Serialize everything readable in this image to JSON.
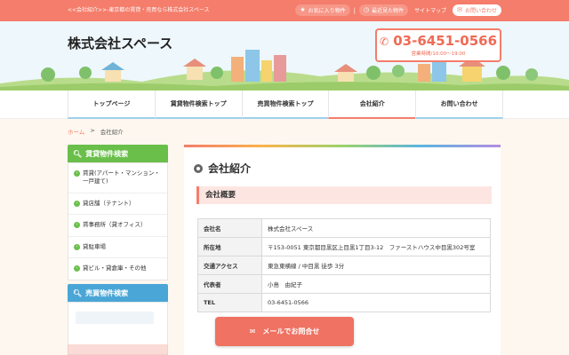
{
  "topbar": {
    "tagline": "<<会社紹介>>-東京都の賃貸・売買なら株式会社スペース",
    "favorites": "お気に入り物件",
    "recent": "最近見た物件",
    "sitemap": "サイトマップ",
    "contact": "お問い合わせ"
  },
  "header": {
    "company": "株式会社スペース",
    "phone": "03-6451-0566",
    "hours": "営業時間/10:00〜19:00"
  },
  "nav": [
    {
      "label": "トップページ"
    },
    {
      "label": "賃貸物件検索トップ"
    },
    {
      "label": "売買物件検索トップ"
    },
    {
      "label": "会社紹介"
    },
    {
      "label": "お問い合わせ"
    }
  ],
  "breadcrumb": {
    "home": "ホーム",
    "sep": ">",
    "current": "会社紹介"
  },
  "sidebar": {
    "rental_title": "賃貸物件検索",
    "rental_items": [
      {
        "label": "賃貸(アパート・マンション・一戸建て)"
      },
      {
        "label": "貸店舗（テナント）"
      },
      {
        "label": "賃事務所（貸オフィス）"
      },
      {
        "label": "貸駐車場"
      },
      {
        "label": "貸ビル・貸倉庫・その他"
      }
    ],
    "sale_title": "売買物件検索"
  },
  "main": {
    "page_title": "会社紹介",
    "section_title": "会社概要",
    "rows": [
      {
        "key": "会社名",
        "value": "株式会社スペース"
      },
      {
        "key": "所在地",
        "value": "〒153-0051 東京都目黒区上目黒1丁目3-12　ファーストハウス中目黒302号室"
      },
      {
        "key": "交通アクセス",
        "value": "東急東横線 / 中目黒 徒歩 3分"
      },
      {
        "key": "代表者",
        "value": "小島　由紀子"
      },
      {
        "key": "TEL",
        "value": "03-6451-0566"
      }
    ]
  },
  "mail_button": {
    "label": "メールでお問合せ"
  },
  "colors": {
    "accent": "#f47d6b",
    "green": "#6abf4b",
    "blue": "#4aa6d6"
  }
}
